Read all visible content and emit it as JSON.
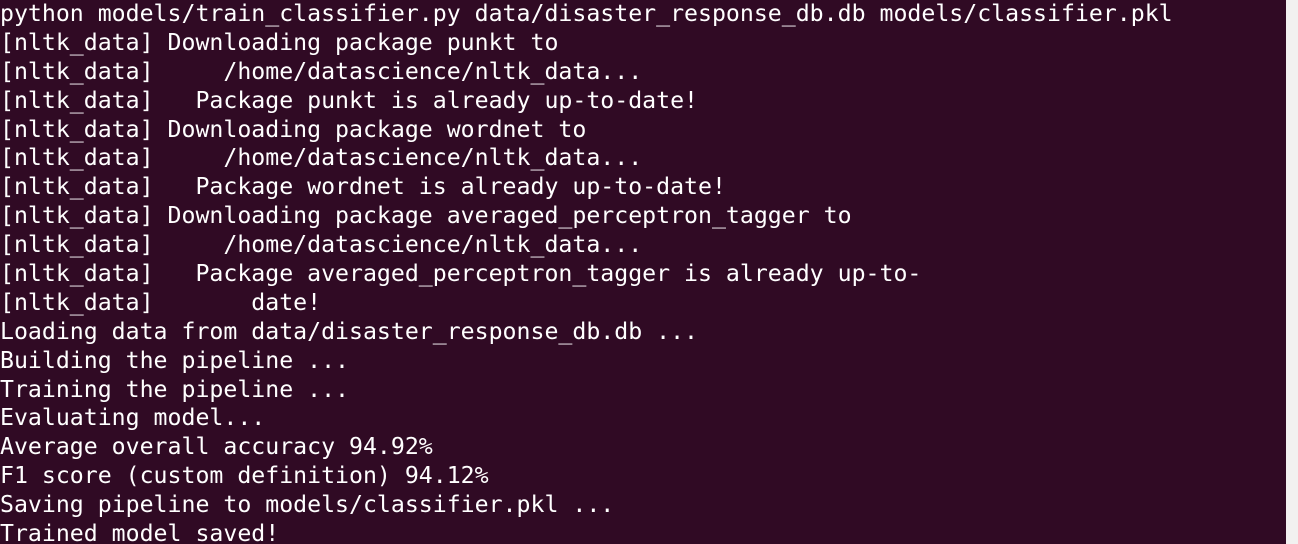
{
  "terminal": {
    "lines": [
      "python models/train_classifier.py data/disaster_response_db.db models/classifier.pkl",
      "[nltk_data] Downloading package punkt to",
      "[nltk_data]     /home/datascience/nltk_data...",
      "[nltk_data]   Package punkt is already up-to-date!",
      "[nltk_data] Downloading package wordnet to",
      "[nltk_data]     /home/datascience/nltk_data...",
      "[nltk_data]   Package wordnet is already up-to-date!",
      "[nltk_data] Downloading package averaged_perceptron_tagger to",
      "[nltk_data]     /home/datascience/nltk_data...",
      "[nltk_data]   Package averaged_perceptron_tagger is already up-to-",
      "[nltk_data]       date!",
      "Loading data from data/disaster_response_db.db ...",
      "Building the pipeline ...",
      "Training the pipeline ...",
      "Evaluating model...",
      "Average overall accuracy 94.92%",
      "F1 score (custom definition) 94.12%",
      "Saving pipeline to models/classifier.pkl ...",
      "Trained model saved!"
    ]
  }
}
